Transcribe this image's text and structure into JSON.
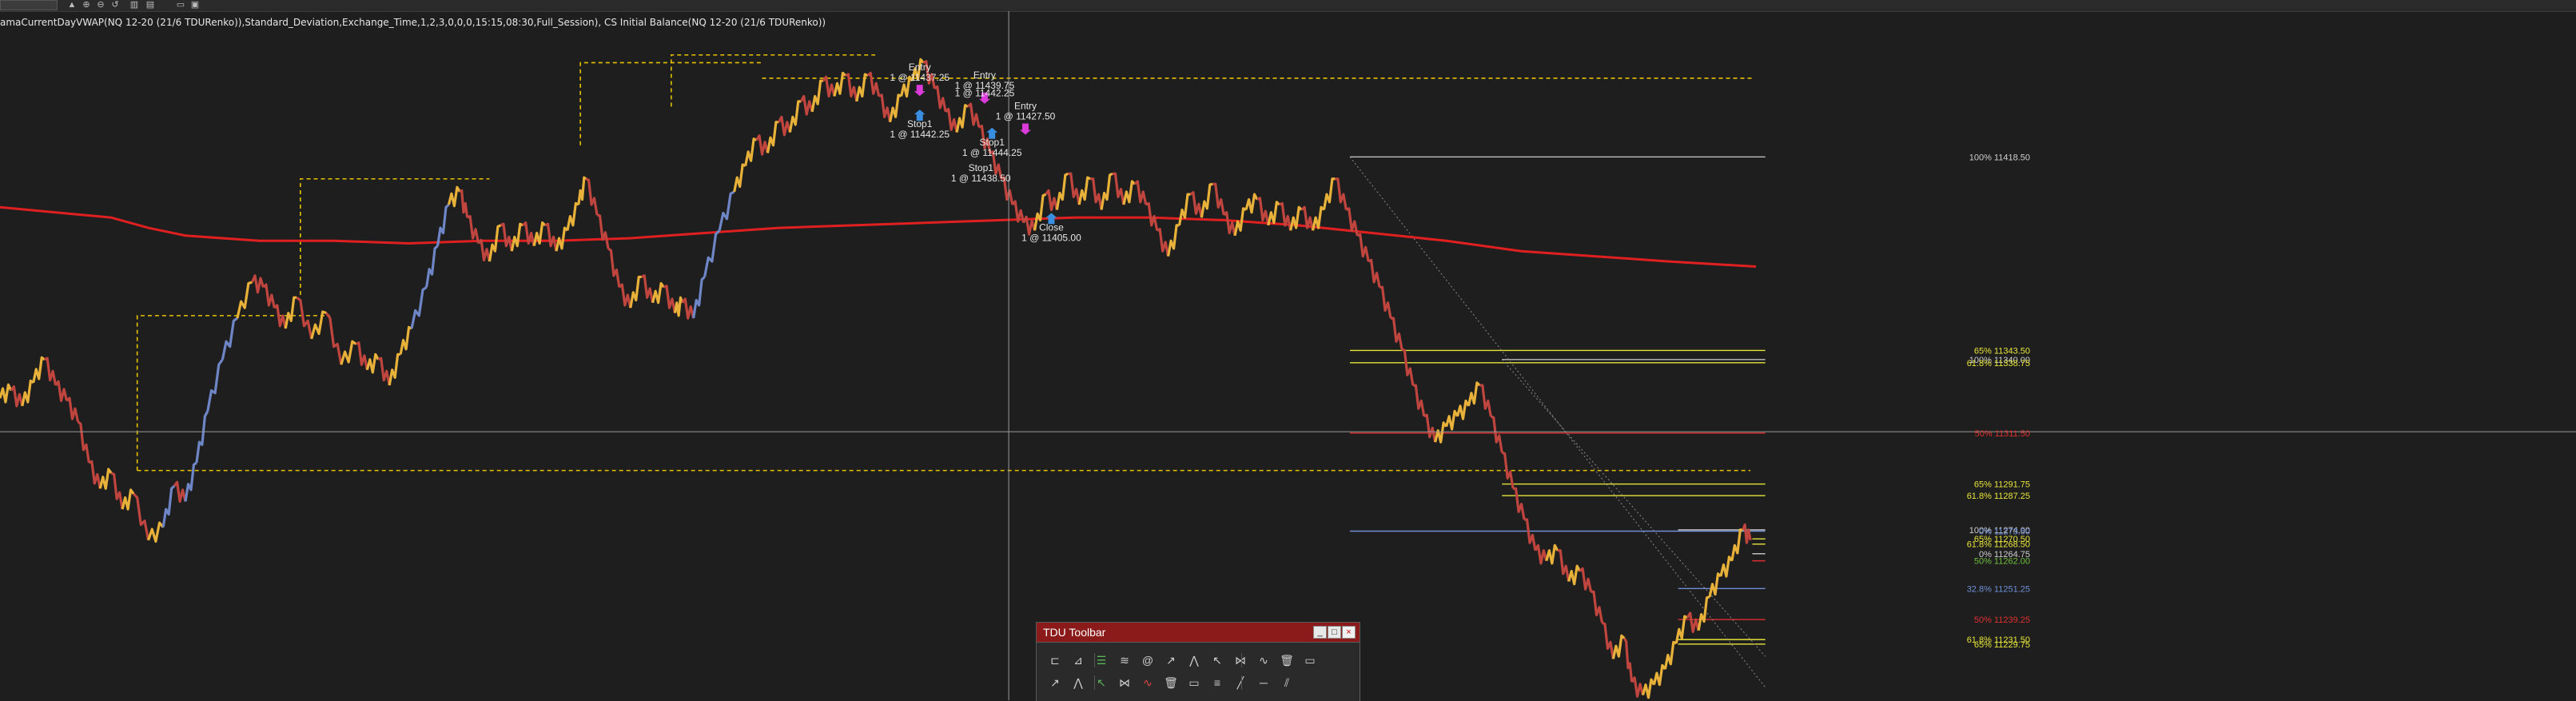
{
  "window": {
    "indicator_line": "amaCurrentDayVWAP(NQ 12-20 (21/6 TDURenko)),Standard_Deviation,Exchange_Time,1,2,3,0,0,0,15:15,08:30,Full_Session), CS Initial Balance(NQ 12-20 (21/6 TDURenko))"
  },
  "toolbar": {
    "title": "TDU Toolbar",
    "minimize_label": "_",
    "restore_label": "□",
    "close_label": "×",
    "tools_row1": [
      "trash-icon",
      "ruler-icon",
      "lines-icon",
      "line-icon",
      "hline-icon",
      "channel-icon",
      "fib-icon",
      "grid-icon",
      "fan-icon",
      "fib-time-icon",
      "pitchfork-icon",
      "parallel-icon"
    ],
    "tools_row2": [
      "arc-icon",
      "fib-ext-icon",
      "gann-icon",
      "fib-cluster-icon",
      "fib-levels-icon",
      "fib-spiral-icon",
      "ray-icon",
      "zigzag-icon",
      "arrow-icon",
      "pattern-icon",
      "wave-icon"
    ]
  },
  "chart_data": {
    "type": "line",
    "instrument": "NQ 12-20 (21/6 TDURenko)",
    "colors": {
      "up": "#e8b23a",
      "down": "#c0453f",
      "trend_up": "#6e85c6",
      "vwap": "#e02020",
      "ib": "#e6c200",
      "fib_yellow": "#e7e53a",
      "fib_red": "#e03030",
      "fib_blue": "#6e8fd6",
      "fib_white": "#bfbfbf",
      "fib_green": "#6fbf3a"
    },
    "ylim": [
      11208,
      11470
    ],
    "xlim": [
      0,
      1000
    ],
    "price": [
      [
        0,
        11325
      ],
      [
        6,
        11328
      ],
      [
        12,
        11322
      ],
      [
        18,
        11331
      ],
      [
        24,
        11340
      ],
      [
        30,
        11330
      ],
      [
        36,
        11324
      ],
      [
        42,
        11316
      ],
      [
        48,
        11300
      ],
      [
        54,
        11290
      ],
      [
        60,
        11296
      ],
      [
        66,
        11282
      ],
      [
        72,
        11288
      ],
      [
        80,
        11270
      ],
      [
        88,
        11275
      ],
      [
        94,
        11291
      ],
      [
        100,
        11285
      ],
      [
        106,
        11300
      ],
      [
        112,
        11320
      ],
      [
        120,
        11340
      ],
      [
        128,
        11356
      ],
      [
        136,
        11370
      ],
      [
        142,
        11368
      ],
      [
        148,
        11360
      ],
      [
        154,
        11352
      ],
      [
        160,
        11364
      ],
      [
        168,
        11348
      ],
      [
        176,
        11358
      ],
      [
        184,
        11338
      ],
      [
        192,
        11346
      ],
      [
        198,
        11336
      ],
      [
        204,
        11340
      ],
      [
        210,
        11330
      ],
      [
        216,
        11342
      ],
      [
        222,
        11352
      ],
      [
        230,
        11368
      ],
      [
        236,
        11384
      ],
      [
        242,
        11400
      ],
      [
        248,
        11405
      ],
      [
        252,
        11395
      ],
      [
        258,
        11385
      ],
      [
        264,
        11378
      ],
      [
        270,
        11392
      ],
      [
        276,
        11382
      ],
      [
        282,
        11392
      ],
      [
        288,
        11384
      ],
      [
        294,
        11392
      ],
      [
        300,
        11382
      ],
      [
        306,
        11390
      ],
      [
        312,
        11400
      ],
      [
        316,
        11410
      ],
      [
        322,
        11396
      ],
      [
        328,
        11383
      ],
      [
        334,
        11368
      ],
      [
        340,
        11360
      ],
      [
        346,
        11372
      ],
      [
        352,
        11362
      ],
      [
        358,
        11368
      ],
      [
        364,
        11358
      ],
      [
        368,
        11362
      ],
      [
        374,
        11356
      ],
      [
        380,
        11372
      ],
      [
        388,
        11390
      ],
      [
        396,
        11405
      ],
      [
        402,
        11415
      ],
      [
        408,
        11425
      ],
      [
        414,
        11420
      ],
      [
        420,
        11432
      ],
      [
        426,
        11428
      ],
      [
        432,
        11440
      ],
      [
        438,
        11436
      ],
      [
        444,
        11448
      ],
      [
        450,
        11442
      ],
      [
        456,
        11450
      ],
      [
        462,
        11440
      ],
      [
        468,
        11450
      ],
      [
        474,
        11442
      ],
      [
        480,
        11432
      ],
      [
        486,
        11442
      ],
      [
        492,
        11448
      ],
      [
        498,
        11455
      ],
      [
        504,
        11445
      ],
      [
        510,
        11436
      ],
      [
        516,
        11428
      ],
      [
        522,
        11438
      ],
      [
        528,
        11430
      ],
      [
        534,
        11420
      ],
      [
        540,
        11410
      ],
      [
        546,
        11400
      ],
      [
        552,
        11393
      ],
      [
        558,
        11390
      ],
      [
        564,
        11404
      ],
      [
        570,
        11398
      ],
      [
        576,
        11412
      ],
      [
        582,
        11400
      ],
      [
        588,
        11410
      ],
      [
        594,
        11398
      ],
      [
        600,
        11412
      ],
      [
        606,
        11400
      ],
      [
        612,
        11408
      ],
      [
        618,
        11400
      ],
      [
        624,
        11390
      ],
      [
        630,
        11380
      ],
      [
        636,
        11392
      ],
      [
        642,
        11404
      ],
      [
        648,
        11395
      ],
      [
        654,
        11408
      ],
      [
        660,
        11396
      ],
      [
        666,
        11388
      ],
      [
        672,
        11398
      ],
      [
        678,
        11402
      ],
      [
        684,
        11392
      ],
      [
        690,
        11400
      ],
      [
        696,
        11390
      ],
      [
        702,
        11398
      ],
      [
        708,
        11390
      ],
      [
        714,
        11398
      ],
      [
        720,
        11410
      ],
      [
        726,
        11398
      ],
      [
        732,
        11388
      ],
      [
        738,
        11378
      ],
      [
        744,
        11368
      ],
      [
        750,
        11356
      ],
      [
        756,
        11344
      ],
      [
        762,
        11330
      ],
      [
        768,
        11318
      ],
      [
        774,
        11308
      ],
      [
        780,
        11314
      ],
      [
        786,
        11318
      ],
      [
        792,
        11322
      ],
      [
        798,
        11330
      ],
      [
        804,
        11318
      ],
      [
        810,
        11304
      ],
      [
        816,
        11290
      ],
      [
        822,
        11278
      ],
      [
        828,
        11266
      ],
      [
        834,
        11262
      ],
      [
        840,
        11266
      ],
      [
        846,
        11254
      ],
      [
        852,
        11258
      ],
      [
        858,
        11250
      ],
      [
        864,
        11238
      ],
      [
        870,
        11224
      ],
      [
        876,
        11232
      ],
      [
        880,
        11215
      ],
      [
        886,
        11210
      ],
      [
        892,
        11214
      ],
      [
        898,
        11220
      ],
      [
        904,
        11230
      ],
      [
        910,
        11240
      ],
      [
        916,
        11235
      ],
      [
        922,
        11248
      ],
      [
        928,
        11256
      ],
      [
        934,
        11262
      ],
      [
        940,
        11274
      ],
      [
        944,
        11270
      ]
    ],
    "vwap_line": [
      [
        0,
        11399
      ],
      [
        30,
        11397
      ],
      [
        60,
        11395
      ],
      [
        80,
        11391
      ],
      [
        100,
        11388
      ],
      [
        140,
        11386
      ],
      [
        180,
        11386
      ],
      [
        220,
        11385
      ],
      [
        260,
        11386
      ],
      [
        300,
        11386
      ],
      [
        340,
        11387
      ],
      [
        380,
        11389
      ],
      [
        420,
        11391
      ],
      [
        460,
        11392
      ],
      [
        500,
        11393
      ],
      [
        540,
        11394
      ],
      [
        580,
        11395
      ],
      [
        620,
        11395
      ],
      [
        660,
        11394
      ],
      [
        700,
        11392
      ],
      [
        740,
        11389
      ],
      [
        780,
        11386
      ],
      [
        820,
        11382
      ],
      [
        860,
        11380
      ],
      [
        900,
        11378
      ],
      [
        947,
        11376
      ]
    ],
    "ib_boxes": [
      {
        "x0": 74,
        "x1": 178,
        "high": 11357,
        "low": 11297
      },
      {
        "x0": 162,
        "x1": 264,
        "high": 11410,
        "low": 11365
      },
      {
        "x0": 313,
        "x1": 411,
        "high": 11455,
        "low": 11423
      },
      {
        "x0": 362,
        "x1": 472,
        "high": 11458,
        "low": 11438
      }
    ],
    "ib_top_line": {
      "x0": 411,
      "x1": 945,
      "y": 11449
    },
    "ib_bottom_line": {
      "x0": 74,
      "x1": 944,
      "y": 11297
    },
    "fib_levels": [
      {
        "label": "100% 11418.50",
        "price": 11418.5,
        "x0": 728,
        "x1": 952,
        "color": "#bfbfbf",
        "label_color": "#cfcfcf"
      },
      {
        "label": "65% 11343.50",
        "price": 11343.5,
        "x0": 728,
        "x1": 952,
        "color": "#e7e53a",
        "label_color": "#e7e53a"
      },
      {
        "label": "100% 11340.00",
        "price": 11340.0,
        "x0": 810,
        "x1": 952,
        "color": "#bfbfbf",
        "label_color": "#cfcfcf"
      },
      {
        "label": "61.8% 11338.75",
        "price": 11338.75,
        "x0": 728,
        "x1": 952,
        "color": "#e7e53a",
        "label_color": "#e7e53a"
      },
      {
        "label": "50% 11311.50",
        "price": 11311.5,
        "x0": 728,
        "x1": 952,
        "color": "#e03030",
        "label_color": "#e03030"
      },
      {
        "label": "65% 11291.75",
        "price": 11291.75,
        "x0": 810,
        "x1": 952,
        "color": "#e7e53a",
        "label_color": "#e7e53a"
      },
      {
        "label": "61.8% 11287.25",
        "price": 11287.25,
        "x0": 810,
        "x1": 952,
        "color": "#e7e53a",
        "label_color": "#e7e53a"
      },
      {
        "label": "100% 11274.00",
        "price": 11274.0,
        "x0": 905,
        "x1": 952,
        "color": "#bfbfbf",
        "label_color": "#cfcfcf"
      },
      {
        "label": "0% 11273.50",
        "price": 11273.5,
        "x0": 728,
        "x1": 952,
        "color": "#6e8fd6",
        "label_color": "#6e8fd6"
      },
      {
        "label": "65% 11270.50",
        "price": 11270.5,
        "x0": 945,
        "x1": 952,
        "color": "#e7e53a",
        "label_color": "#e7e53a"
      },
      {
        "label": "61.8% 11268.50",
        "price": 11268.5,
        "x0": 945,
        "x1": 952,
        "color": "#e7e53a",
        "label_color": "#e7e53a"
      },
      {
        "label": "0% 11264.75",
        "price": 11264.75,
        "x0": 945,
        "x1": 952,
        "color": "#bfbfbf",
        "label_color": "#cfcfcf"
      },
      {
        "label": "50% 11262.00",
        "price": 11262.0,
        "x0": 945,
        "x1": 952,
        "color": "#e03030",
        "label_color": "#6fbf3a"
      },
      {
        "label": "32.8% 11251.25",
        "price": 11251.25,
        "x0": 905,
        "x1": 952,
        "color": "#6e8fd6",
        "label_color": "#6e8fd6"
      },
      {
        "label": "50% 11239.25",
        "price": 11239.25,
        "x0": 905,
        "x1": 952,
        "color": "#e03030",
        "label_color": "#e03030"
      },
      {
        "label": "61.8% 11231.50",
        "price": 11231.5,
        "x0": 905,
        "x1": 952,
        "color": "#e7e53a",
        "label_color": "#e7e53a"
      },
      {
        "label": "65% 11229.75",
        "price": 11229.75,
        "x0": 905,
        "x1": 952,
        "color": "#e7e53a",
        "label_color": "#e7e53a"
      }
    ],
    "trade_markers": [
      {
        "text": "Entry",
        "sub": "1 @ 11437.25",
        "x": 496,
        "price": 11452,
        "arrow": "down",
        "arrow_color": "#d93ad9"
      },
      {
        "text": "Stop1",
        "sub": "1 @ 11442.25",
        "x": 496,
        "price": 11430,
        "arrow": "up",
        "arrow_color": "#3a8ee0",
        "below": true
      },
      {
        "text": "Entry",
        "sub": "1 @ 11439.75",
        "x": 531,
        "price": 11449,
        "arrow": "down",
        "arrow_color": "#d93ad9"
      },
      {
        "text": "1 @ 11442.25",
        "sub": "",
        "x": 531,
        "price": 11442,
        "arrow": "none",
        "arrow_color": "#d93ad9"
      },
      {
        "text": "Stop1",
        "sub": "1 @ 11444.25",
        "x": 535,
        "price": 11423,
        "arrow": "up",
        "arrow_color": "#3a8ee0",
        "below": true
      },
      {
        "text": "Stop1",
        "sub": "1 @ 11438.50",
        "x": 529,
        "price": 11413,
        "arrow": "none",
        "arrow_color": "#3a8ee0",
        "below": true
      },
      {
        "text": "Entry",
        "sub": "1 @ 11427.50",
        "x": 553,
        "price": 11437,
        "arrow": "down",
        "arrow_color": "#d93ad9"
      },
      {
        "text": "Close",
        "sub": "1 @ 11405.00",
        "x": 567,
        "price": 11390,
        "arrow": "up",
        "arrow_color": "#3a8ee0",
        "below": true
      }
    ],
    "crosshair": {
      "x": 544,
      "price": 11312
    },
    "trend_diagonals": [
      [
        [
          728,
          11418.5
        ],
        [
          952,
          11213
        ]
      ],
      [
        [
          810,
          11340
        ],
        [
          952,
          11225
        ]
      ]
    ]
  }
}
